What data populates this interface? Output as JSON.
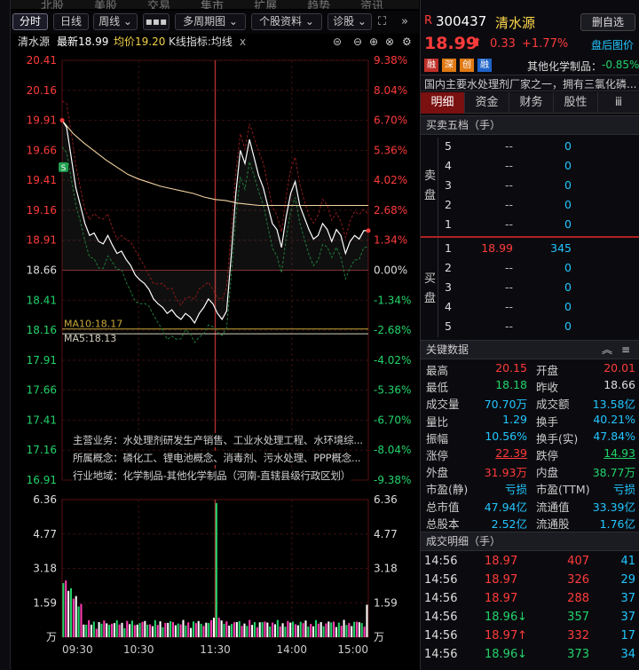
{
  "nav": {
    "items": [
      "北股",
      "美股",
      "交易",
      "集市",
      "扩展",
      "趋势",
      "资讯",
      "帮助"
    ]
  },
  "toolbar": {
    "buttons": [
      "分时",
      "日线",
      "周线 ⌄",
      "▪▪▪",
      "多周期图 ⌄",
      "个股资料 ⌄",
      "诊股 ⌄"
    ]
  },
  "chart_header": {
    "stock": "清水源",
    "latest": "最新18.99",
    "avg": "均价19.20",
    "indicator": "K线指标:均线",
    "close_x": "x"
  },
  "chart_data": {
    "type": "line",
    "y_left_ticks": [
      "20.41",
      "20.16",
      "19.91",
      "19.66",
      "19.41",
      "19.16",
      "18.91",
      "18.66",
      "18.41",
      "18.16",
      "17.91",
      "17.66",
      "17.41",
      "17.16",
      "16.91"
    ],
    "y_right_ticks": [
      "9.38%",
      "8.04%",
      "6.70%",
      "5.36%",
      "4.02%",
      "2.68%",
      "1.34%",
      "0.00%",
      "-1.34%",
      "-2.68%",
      "-4.02%",
      "-5.36%",
      "-6.70%",
      "-8.04%",
      "-9.38%"
    ],
    "ylim": [
      16.91,
      20.41
    ],
    "prev_close": 18.66,
    "x_ticks": [
      "09:30",
      "10:30",
      "11:30",
      "14:00",
      "15:00"
    ],
    "ma_labels": [
      "MA10:18.17",
      "MA5:18.13"
    ],
    "ma_values": [
      18.17,
      18.13
    ],
    "price_series": [
      19.91,
      19.85,
      19.6,
      19.35,
      19.2,
      19.05,
      18.95,
      18.97,
      18.9,
      18.88,
      18.95,
      18.87,
      18.8,
      18.82,
      18.75,
      18.7,
      18.62,
      18.58,
      18.55,
      18.5,
      18.42,
      18.38,
      18.35,
      18.3,
      18.33,
      18.28,
      18.25,
      18.3,
      18.27,
      18.22,
      18.3,
      18.35,
      18.42,
      18.38,
      18.3,
      18.25,
      18.32,
      18.78,
      19.3,
      19.66,
      19.55,
      19.75,
      19.6,
      19.45,
      19.35,
      19.2,
      19.05,
      19.0,
      18.85,
      19.1,
      19.3,
      19.4,
      19.2,
      19.1,
      19.0,
      18.92,
      18.95,
      19.05,
      19.0,
      18.9,
      19.0,
      18.95,
      18.8,
      18.9,
      18.95,
      18.92,
      18.99,
      18.99
    ],
    "avg_series": [
      19.91,
      19.8,
      19.72,
      19.65,
      19.58,
      19.52,
      19.46,
      19.42,
      19.39,
      19.36,
      19.34,
      19.32,
      19.3,
      19.27,
      19.25,
      19.24,
      19.22,
      19.21,
      19.2,
      19.2,
      19.2,
      19.2,
      19.2,
      19.2,
      19.2,
      19.2,
      19.2,
      19.2,
      19.2
    ],
    "vol_ticks_left": [
      "6.36",
      "4.77",
      "3.18",
      "1.59",
      "万"
    ],
    "vol_ticks_right": [
      "6.36",
      "4.77",
      "3.18",
      "1.59",
      "万"
    ],
    "vol_ylim": [
      0,
      6.36
    ]
  },
  "info_box": {
    "line1": "主营业务：水处理剂研发生产销售、工业水处理工程、水环境综...",
    "line2": "所属概念：磷化工、锂电池概念、消毒剂、污水处理、PPP概念...",
    "line3": "行业地域：化学制品-其他化学制品（河南-直辖县级行政区划）"
  },
  "stock": {
    "r_label": "R",
    "code": "300437",
    "name": "清水源",
    "del_btn": "删自选",
    "price": "18.99",
    "arrow": "⬆",
    "change": "0.33",
    "pct": "+1.77%",
    "after_hours": "盘后图价",
    "tags": [
      "融",
      "深",
      "创",
      "融"
    ],
    "sector": "其他化学制品：",
    "sector_pct": "-0.85%",
    "desc": "国内主要水处理剂厂家之一，拥有三氯化磷..."
  },
  "tabs": [
    "明细",
    "资金",
    "财务",
    "股性",
    "ⅲ"
  ],
  "orderbook": {
    "title": "买卖五档（手）",
    "sell_label": "卖盘",
    "buy_label": "买盘",
    "asks": [
      {
        "lvl": "5",
        "price": "--",
        "vol": "0"
      },
      {
        "lvl": "4",
        "price": "--",
        "vol": "0"
      },
      {
        "lvl": "3",
        "price": "--",
        "vol": "0"
      },
      {
        "lvl": "2",
        "price": "--",
        "vol": "0"
      },
      {
        "lvl": "1",
        "price": "--",
        "vol": "0"
      }
    ],
    "bids": [
      {
        "lvl": "1",
        "price": "18.99",
        "vol": "345"
      },
      {
        "lvl": "2",
        "price": "--",
        "vol": "0"
      },
      {
        "lvl": "3",
        "price": "--",
        "vol": "0"
      },
      {
        "lvl": "4",
        "price": "--",
        "vol": "0"
      },
      {
        "lvl": "5",
        "price": "--",
        "vol": "0"
      }
    ]
  },
  "key_data": {
    "title": "关键数据",
    "rows": [
      [
        {
          "l": "最高",
          "v": "20.15",
          "c": "red"
        },
        {
          "l": "开盘",
          "v": "20.01",
          "c": "red"
        }
      ],
      [
        {
          "l": "最低",
          "v": "18.18",
          "c": "grn"
        },
        {
          "l": "昨收",
          "v": "18.66",
          "c": "wht"
        }
      ],
      [
        {
          "l": "成交量",
          "v": "70.70万",
          "c": "cy"
        },
        {
          "l": "成交额",
          "v": "13.58亿",
          "c": "cy"
        }
      ],
      [
        {
          "l": "量比",
          "v": "1.29",
          "c": "cy"
        },
        {
          "l": "换手",
          "v": "40.21%",
          "c": "cy"
        }
      ],
      [
        {
          "l": "振幅",
          "v": "10.56%",
          "c": "cy"
        },
        {
          "l": "换手(实)",
          "v": "47.84%",
          "c": "cy"
        }
      ],
      [
        {
          "l": "涨停",
          "v": "22.39",
          "c": "red"
        },
        {
          "l": "跌停",
          "v": "14.93",
          "c": "grn"
        }
      ],
      [
        {
          "l": "外盘",
          "v": "31.93万",
          "c": "red"
        },
        {
          "l": "内盘",
          "v": "38.77万",
          "c": "grn"
        }
      ],
      [
        {
          "l": "市盈(静)",
          "v": "亏损",
          "c": "cy"
        },
        {
          "l": "市盈(TTM)",
          "v": "亏损",
          "c": "cy"
        }
      ],
      [
        {
          "l": "总市值",
          "v": "47.94亿",
          "c": "cy"
        },
        {
          "l": "流通值",
          "v": "33.39亿",
          "c": "cy"
        }
      ],
      [
        {
          "l": "总股本",
          "v": "2.52亿",
          "c": "cy"
        },
        {
          "l": "流通股",
          "v": "1.76亿",
          "c": "cy"
        }
      ]
    ]
  },
  "trades": {
    "title": "成交明细（手）",
    "rows": [
      {
        "t": "14:56",
        "p": "18.97",
        "a": "",
        "v": "407",
        "n": "41",
        "c": "red"
      },
      {
        "t": "14:56",
        "p": "18.97",
        "a": "",
        "v": "326",
        "n": "29",
        "c": "red"
      },
      {
        "t": "14:56",
        "p": "18.97",
        "a": "",
        "v": "288",
        "n": "37",
        "c": "red"
      },
      {
        "t": "14:56",
        "p": "18.96",
        "a": "↓",
        "v": "357",
        "n": "37",
        "c": "grn"
      },
      {
        "t": "14:56",
        "p": "18.97",
        "a": "↑",
        "v": "332",
        "n": "17",
        "c": "red"
      },
      {
        "t": "14:56",
        "p": "18.96",
        "a": "↓",
        "v": "373",
        "n": "34",
        "c": "grn"
      }
    ]
  },
  "colors": {
    "up": "#ff3b3b",
    "down": "#22d36a",
    "accent": "#22c6ff",
    "grid": "#3a1010"
  }
}
